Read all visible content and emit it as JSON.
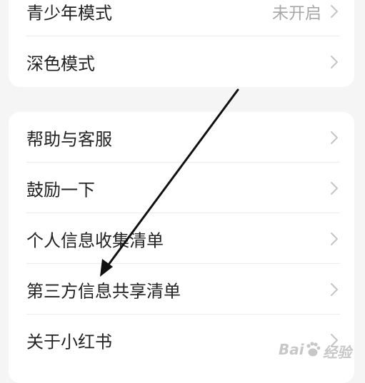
{
  "settings": {
    "group1": [
      {
        "label": "青少年模式",
        "value": "未开启"
      },
      {
        "label": "深色模式",
        "value": ""
      }
    ],
    "group2": [
      {
        "label": "帮助与客服"
      },
      {
        "label": "鼓励一下"
      },
      {
        "label": "个人信息收集清单"
      },
      {
        "label": "第三方信息共享清单"
      },
      {
        "label": "关于小红书"
      }
    ]
  },
  "watermark": {
    "logo_text": "Bai",
    "logo_suffix": "经验"
  },
  "colors": {
    "background": "#f5f5f5",
    "card": "#ffffff",
    "text": "#222222",
    "muted": "#a8a8a8",
    "annotation_arrow": "#111111"
  },
  "icons": {
    "row_chevron": "chevron-right-icon",
    "annotation": "annotation-arrow-icon",
    "watermark": "baidu-paw-icon"
  }
}
